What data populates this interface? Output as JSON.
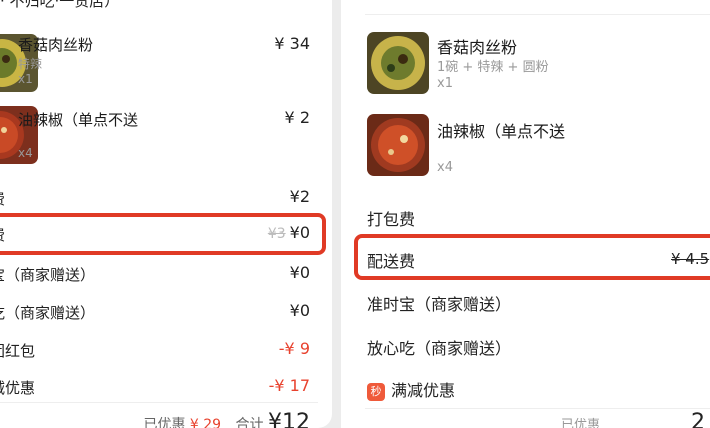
{
  "left": {
    "store_title": "· 不归吃·一贵店）",
    "items": [
      {
        "name": "香菇肉丝粉",
        "spec": "特辣",
        "qty": "x1",
        "price": "¥ 34"
      },
      {
        "name": "油辣椒（单点不送",
        "spec": "",
        "qty": "x4",
        "price": "¥ 2"
      }
    ],
    "fees": [
      {
        "label": "费",
        "original": "",
        "price": "¥2"
      },
      {
        "label": "费",
        "original": "¥3",
        "price": "¥0"
      },
      {
        "label": "宝（商家赠送）",
        "original": "",
        "price": "¥0"
      },
      {
        "label": "吃（商家赠送）",
        "original": "",
        "price": "¥0"
      },
      {
        "label": "团红包",
        "original": "",
        "price": "-¥ 9"
      },
      {
        "label": "减优惠",
        "original": "",
        "price": "-¥ 17"
      }
    ],
    "footer": {
      "saved_label": "已优惠",
      "saved_value": "¥ 29",
      "total_label": "合计",
      "total_value": "¥12"
    }
  },
  "right": {
    "items": [
      {
        "name": "香菇肉丝粉",
        "spec": "1碗 + 特辣 + 圆粉",
        "qty": "x1"
      },
      {
        "name": "油辣椒（单点不送",
        "spec": "",
        "qty": "x4"
      }
    ],
    "fees": [
      {
        "label": "打包费",
        "original": ""
      },
      {
        "label": "配送费",
        "original": "¥ 4.5"
      },
      {
        "label": "准时宝（商家赠送）",
        "original": ""
      },
      {
        "label": "放心吃（商家赠送）",
        "original": ""
      },
      {
        "label": "满减优惠",
        "original": "",
        "badge": "秒"
      }
    ],
    "footer": {
      "saved_label": "已优惠",
      "total_value": "2"
    }
  },
  "colors": {
    "highlight": "#e03a25",
    "discount": "#e8422e",
    "badge": "#ef5a3a"
  }
}
